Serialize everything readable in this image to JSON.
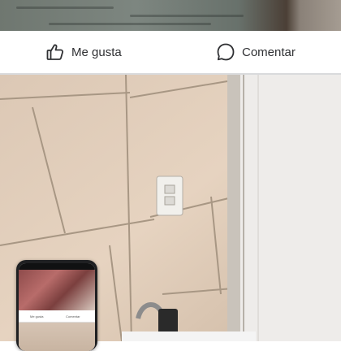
{
  "post_actions": {
    "like_label": "Me gusta",
    "comment_label": "Comentar",
    "like_icon": "thumbs-up-icon",
    "comment_icon": "speech-bubble-icon"
  },
  "pip_preview": {
    "like_label": "Me gusta",
    "comment_label": "Comentar"
  },
  "colors": {
    "text": "#2f3033",
    "divider": "#d9dadc",
    "tile": "#d9c7b6"
  }
}
